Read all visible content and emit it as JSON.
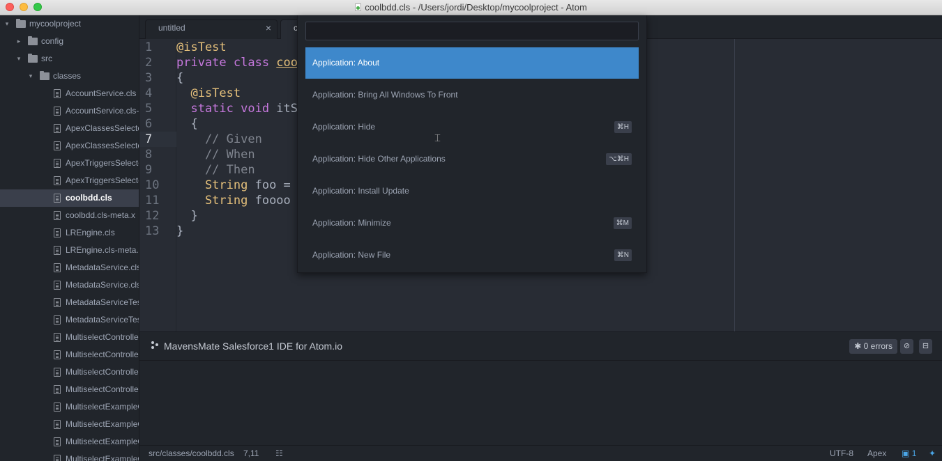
{
  "window": {
    "title": "coolbdd.cls - /Users/jordi/Desktop/mycoolproject - Atom"
  },
  "sidebar": {
    "items": [
      {
        "label": "mycoolproject",
        "type": "folder",
        "expanded": true,
        "depth": 0
      },
      {
        "label": "config",
        "type": "folder",
        "expanded": false,
        "depth": 1
      },
      {
        "label": "src",
        "type": "folder",
        "expanded": true,
        "depth": 1
      },
      {
        "label": "classes",
        "type": "folder",
        "expanded": true,
        "depth": 2
      },
      {
        "label": "AccountService.cls",
        "type": "file",
        "depth": 3
      },
      {
        "label": "AccountService.cls-",
        "type": "file",
        "depth": 3
      },
      {
        "label": "ApexClassesSelecto",
        "type": "file",
        "depth": 3
      },
      {
        "label": "ApexClassesSelecto",
        "type": "file",
        "depth": 3
      },
      {
        "label": "ApexTriggersSelecto",
        "type": "file",
        "depth": 3
      },
      {
        "label": "ApexTriggersSelecto",
        "type": "file",
        "depth": 3
      },
      {
        "label": "coolbdd.cls",
        "type": "file",
        "depth": 3,
        "selected": true
      },
      {
        "label": "coolbdd.cls-meta.x",
        "type": "file",
        "depth": 3
      },
      {
        "label": "LREngine.cls",
        "type": "file",
        "depth": 3
      },
      {
        "label": "LREngine.cls-meta.x",
        "type": "file",
        "depth": 3
      },
      {
        "label": "MetadataService.cls",
        "type": "file",
        "depth": 3
      },
      {
        "label": "MetadataService.cls-",
        "type": "file",
        "depth": 3
      },
      {
        "label": "MetadataServiceTes",
        "type": "file",
        "depth": 3
      },
      {
        "label": "MetadataServiceTes",
        "type": "file",
        "depth": 3
      },
      {
        "label": "MultiselectControlle",
        "type": "file",
        "depth": 3
      },
      {
        "label": "MultiselectControlle",
        "type": "file",
        "depth": 3
      },
      {
        "label": "MultiselectControlle",
        "type": "file",
        "depth": 3
      },
      {
        "label": "MultiselectControlle",
        "type": "file",
        "depth": 3
      },
      {
        "label": "MultiselectExampleC",
        "type": "file",
        "depth": 3
      },
      {
        "label": "MultiselectExampleC",
        "type": "file",
        "depth": 3
      },
      {
        "label": "MultiselectExampleC",
        "type": "file",
        "depth": 3
      },
      {
        "label": "MultiselectExampleC",
        "type": "file",
        "depth": 3
      }
    ]
  },
  "tabs": [
    {
      "label": "untitled",
      "close": "×"
    },
    {
      "label": "co",
      "close": ""
    }
  ],
  "editor": {
    "lines": [
      {
        "num": "1",
        "segments": [
          {
            "t": "ann",
            "v": "@isTest"
          }
        ]
      },
      {
        "num": "2",
        "segments": [
          {
            "t": "kw",
            "v": "private class "
          },
          {
            "t": "cls",
            "v": "coo"
          }
        ]
      },
      {
        "num": "3",
        "segments": [
          {
            "t": "",
            "v": "{"
          }
        ]
      },
      {
        "num": "4",
        "segments": [
          {
            "t": "ann",
            "v": "  @isTest"
          }
        ]
      },
      {
        "num": "5",
        "segments": [
          {
            "t": "kw",
            "v": "  static void "
          },
          {
            "t": "",
            "v": "itSh"
          }
        ]
      },
      {
        "num": "6",
        "segments": [
          {
            "t": "",
            "v": "  {"
          }
        ]
      },
      {
        "num": "7",
        "segments": [
          {
            "t": "cmt",
            "v": "    // Given"
          }
        ],
        "cursor": true
      },
      {
        "num": "8",
        "segments": [
          {
            "t": "cmt",
            "v": "    // When"
          }
        ]
      },
      {
        "num": "9",
        "segments": [
          {
            "t": "cmt",
            "v": "    // Then"
          }
        ]
      },
      {
        "num": "10",
        "segments": [
          {
            "t": "ann",
            "v": "    String "
          },
          {
            "t": "",
            "v": "foo ="
          }
        ]
      },
      {
        "num": "11",
        "segments": [
          {
            "t": "ann",
            "v": "    String "
          },
          {
            "t": "",
            "v": "foooo"
          }
        ]
      },
      {
        "num": "12",
        "segments": [
          {
            "t": "",
            "v": "  }"
          }
        ]
      },
      {
        "num": "13",
        "segments": [
          {
            "t": "",
            "v": "}"
          }
        ]
      }
    ]
  },
  "palette": {
    "query": "",
    "commands": [
      {
        "label": "Application: About",
        "shortcut": "",
        "selected": true
      },
      {
        "label": "Application: Bring All Windows To Front",
        "shortcut": ""
      },
      {
        "label": "Application: Hide",
        "shortcut": "⌘H"
      },
      {
        "label": "Application: Hide Other Applications",
        "shortcut": "⌥⌘H"
      },
      {
        "label": "Application: Install Update",
        "shortcut": ""
      },
      {
        "label": "Application: Minimize",
        "shortcut": "⌘M"
      },
      {
        "label": "Application: New File",
        "shortcut": "⌘N"
      }
    ]
  },
  "panel": {
    "title": "MavensMate Salesforce1 IDE for Atom.io",
    "errors_label": "0 errors"
  },
  "status": {
    "path": "src/classes/coolbdd.cls",
    "cursor": "7,11",
    "encoding": "UTF-8",
    "grammar": "Apex",
    "updates": "1"
  },
  "colors": {
    "selection": "#3e88cb",
    "background": "#282c34",
    "sidebar": "#21252b"
  }
}
